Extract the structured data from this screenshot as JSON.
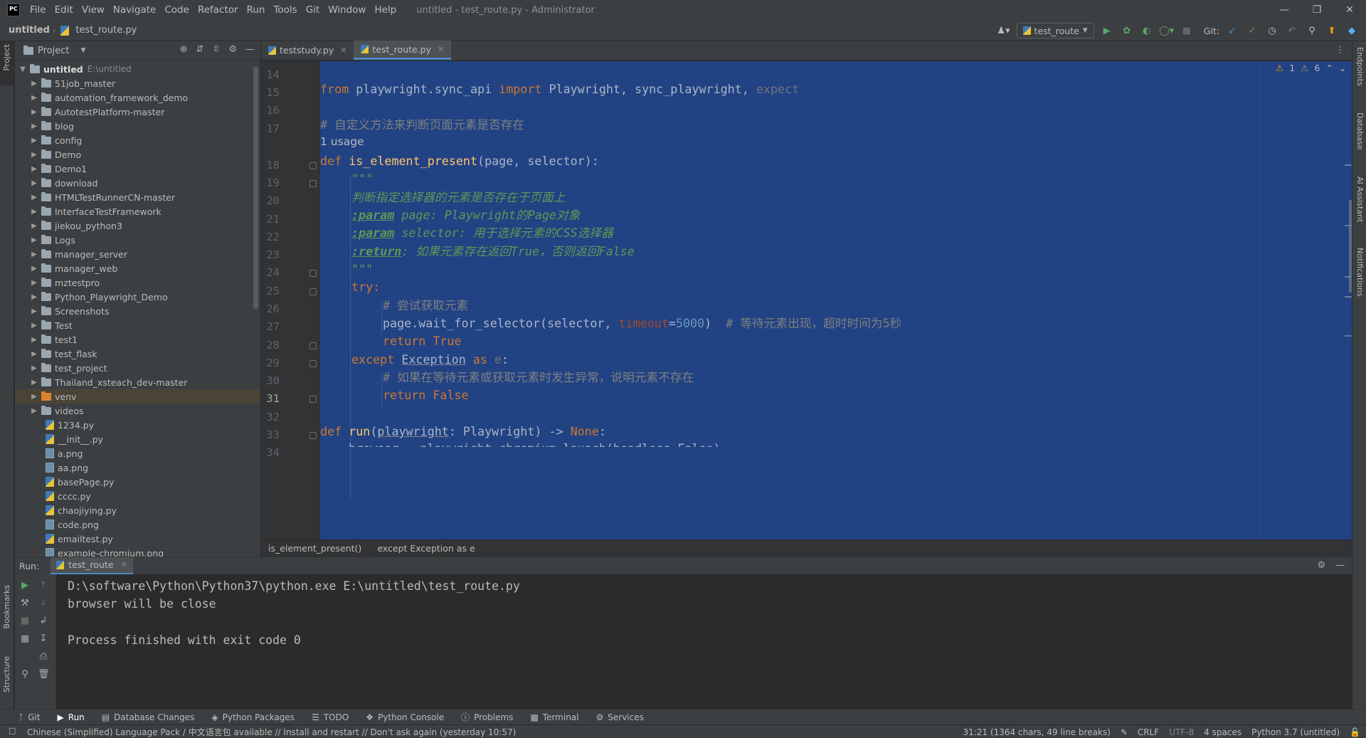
{
  "menu": {
    "logo": "PC",
    "items": [
      "File",
      "Edit",
      "View",
      "Navigate",
      "Code",
      "Refactor",
      "Run",
      "Tools",
      "Git",
      "Window",
      "Help"
    ],
    "window_title": "untitled - test_route.py - Administrator"
  },
  "nav": {
    "root": "untitled",
    "file": "test_route.py",
    "run_config": "test_route",
    "git_label": "Git:"
  },
  "left_stripe": {
    "project": "Project",
    "bookmarks": "Bookmarks",
    "structure": "Structure"
  },
  "right_stripe": {
    "endpoints": "Endpoints",
    "database": "Database",
    "ai": "AI Assistant",
    "notifications": "Notifications"
  },
  "project": {
    "title": "Project",
    "root_name": "untitled",
    "root_path": "E:\\untitled",
    "folders": [
      "51job_master",
      "automation_framework_demo",
      "AutotestPlatform-master",
      "blog",
      "config",
      "Demo",
      "Demo1",
      "download",
      "HTMLTestRunnerCN-master",
      "InterfaceTestFramework",
      "jiekou_python3",
      "Logs",
      "manager_server",
      "manager_web",
      "mztestpro",
      "Python_Playwright_Demo",
      "Screenshots",
      "Test",
      "test1",
      "test_flask",
      "test_project",
      "Thailand_xsteach_dev-master",
      "venv",
      "videos"
    ],
    "files": [
      {
        "name": "1234.py",
        "type": "py"
      },
      {
        "name": "__init__.py",
        "type": "py"
      },
      {
        "name": "a.png",
        "type": "png"
      },
      {
        "name": "aa.png",
        "type": "png"
      },
      {
        "name": "basePage.py",
        "type": "py"
      },
      {
        "name": "cccc.py",
        "type": "py"
      },
      {
        "name": "chaojiying.py",
        "type": "py"
      },
      {
        "name": "code.png",
        "type": "png"
      },
      {
        "name": "emailtest.py",
        "type": "py"
      },
      {
        "name": "example-chromium.png",
        "type": "png"
      }
    ]
  },
  "tabs": [
    {
      "label": "teststudy.py",
      "active": false
    },
    {
      "label": "test_route.py",
      "active": true
    }
  ],
  "editor": {
    "line_numbers": [
      "14",
      "15",
      "16",
      "17",
      "",
      "18",
      "19",
      "20",
      "21",
      "22",
      "23",
      "24",
      "25",
      "26",
      "27",
      "28",
      "29",
      "30",
      "31",
      "32",
      "33",
      "34"
    ],
    "current_line": "31",
    "usage_hint": "1 usage",
    "warnings": "1",
    "weak_warnings": "6",
    "lines": {
      "l15_a": "from",
      "l15_b": " playwright.sync_api ",
      "l15_c": "import",
      "l15_d": " Playwright, sync_playwright, ",
      "l15_e": "expect",
      "l17": "# 自定义方法来判断页面元素是否存在",
      "l18_a": "def ",
      "l18_b": "is_element_present",
      "l18_c": "(page, selector):",
      "l19": "\"\"\"",
      "l20": "判断指定选择器的元素是否存在于页面上",
      "l21_tag": ":param",
      "l21_rest": " page: Playwright的Page对象",
      "l22_tag": ":param",
      "l22_rest": " selector: 用于选择元素的CSS选择器",
      "l23_tag": ":return",
      "l23_rest": ": 如果元素存在返回True，否则返回False",
      "l24": "\"\"\"",
      "l25": "try:",
      "l26": "# 尝试获取元素",
      "l27_a": "page.wait_for_selector(selector, ",
      "l27_b": "timeout",
      "l27_c": "=",
      "l27_d": "5000",
      "l27_e": ")  ",
      "l27_f": "# 等待元素出现，超时时间为5秒",
      "l28_a": "return ",
      "l28_b": "True",
      "l29_a": "except ",
      "l29_b": "Exception",
      "l29_c": " as ",
      "l29_d": "e",
      "l29_e": ":",
      "l30": "# 如果在等待元素或获取元素时发生异常，说明元素不存在",
      "l31_a": "return ",
      "l31_b": "False",
      "l33_a": "def ",
      "l33_b": "run",
      "l33_c": "(",
      "l33_d": "playwright",
      "l33_e": ": Playwright) -> ",
      "l33_f": "None",
      "l33_g": ":",
      "l34": "    browser = playwright.chromium.launch(headless=False)"
    }
  },
  "breadcrumbs": [
    "is_element_present()",
    "except Exception as e"
  ],
  "run": {
    "label": "Run:",
    "tab": "test_route",
    "output": [
      "D:\\software\\Python\\Python37\\python.exe E:\\untitled\\test_route.py",
      "browser will be close",
      "",
      "Process finished with exit code 0"
    ]
  },
  "tool_windows": [
    "Git",
    "Run",
    "Database Changes",
    "Python Packages",
    "TODO",
    "Python Console",
    "Problems",
    "Terminal",
    "Services"
  ],
  "status": {
    "message": "Chinese (Simplified) Language Pack / 中文语言包 available // Install and restart // Don't ask again (yesterday 10:57)",
    "position": "31:21 (1364 chars, 49 line breaks)",
    "line_sep": "CRLF",
    "encoding": "UTF-8",
    "indent": "4 spaces",
    "interpreter": "Python 3.7 (untitled)"
  },
  "colors": {
    "selection": "#214283",
    "accent": "#4a88c7",
    "panel": "#3c3f41",
    "editor": "#2b2b2b"
  }
}
